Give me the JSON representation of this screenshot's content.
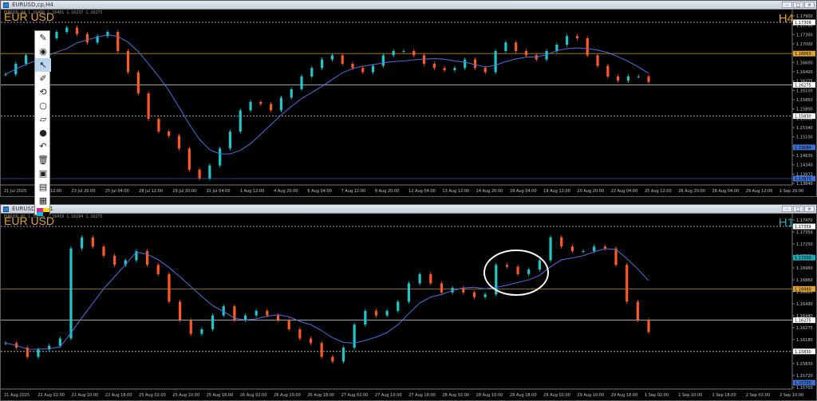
{
  "windows": [
    {
      "title": "EURUSD,cp,H4",
      "info": "EURUSD,H4 1.16466 1.16481 1.16237 1.16275",
      "symbol": "EUR USD",
      "timeframe": "H4",
      "timeframe_color": "#e0a32e",
      "price_ticks": [
        "1.17900",
        "1.17700",
        "1.17300",
        "1.17000",
        "1.16890",
        "1.16600",
        "1.16400",
        "1.16275",
        "1.16100",
        "1.15850",
        "1.15800",
        "1.15560",
        "1.15340",
        "1.15100",
        "1.14800",
        "1.14630",
        "1.14340",
        "1.13973",
        "1.13840"
      ],
      "time_labels": [
        "21 Jul 2025",
        "22 Jul 12:00",
        "23 Jul 20:00",
        "25 Jul 04:00",
        "28 Jul 12:00",
        "29 Jul 20:00",
        "31 Jul 04:00",
        "1 Aug 12:00",
        "4 Aug 20:00",
        "6 Aug 04:00",
        "7 Aug 12:00",
        "8 Aug 20:00",
        "12 Aug 04:00",
        "13 Aug 12:00",
        "14 Aug 20:00",
        "18 Aug 04:00",
        "19 Aug 12:00",
        "20 Aug 20:00",
        "22 Aug 04:00",
        "25 Aug 12:00",
        "26 Aug 20:00",
        "28 Aug 04:00",
        "29 Aug 12:00",
        "1 Sep 20:00"
      ],
      "level_tags": [
        {
          "text": "1.17309",
          "type": "dotted",
          "color": "#ffffff"
        },
        {
          "text": "1.16863",
          "type": "solid",
          "color": "#e0a32e"
        },
        {
          "text": "1.16275",
          "type": "solid",
          "color": "#ffffff"
        },
        {
          "text": "1.15830",
          "type": "dotted",
          "color": "#ffffff"
        },
        {
          "text": "1.15684",
          "type": "tag",
          "color": "#3b6fd0"
        },
        {
          "text": "1.13973",
          "type": "solid",
          "color": "#3b6fd0"
        }
      ]
    },
    {
      "title": "EURUSD,cp,H1",
      "info": "EURUSD,H1 1.16374 1.16419 1.16284 1.16275",
      "symbol": "EUR USD",
      "timeframe": "H1",
      "timeframe_color": "#1aa7b0",
      "price_ticks": [
        "1.17470",
        "1.17359",
        "1.17250",
        "1.17030",
        "1.16960",
        "1.16860",
        "1.16620",
        "1.16490",
        "1.16440",
        "1.16275",
        "1.16180",
        "1.16060",
        "1.15830",
        "1.15720",
        "1.15700"
      ],
      "time_labels": [
        "21 Aug 2025",
        "22 Aug 02:00",
        "22 Aug 10:00",
        "22 Aug 18:00",
        "25 Aug 02:00",
        "25 Aug 10:00",
        "25 Aug 18:00",
        "26 Aug 02:00",
        "26 Aug 10:00",
        "26 Aug 18:00",
        "27 Aug 02:00",
        "27 Aug 10:00",
        "27 Aug 18:00",
        "28 Aug 02:00",
        "28 Aug 10:00",
        "28 Aug 18:00",
        "29 Aug 02:00",
        "29 Aug 10:00",
        "29 Aug 18:00",
        "1 Sep 02:00",
        "1 Sep 10:00",
        "1 Sep 18:00",
        "2 Sep 02:00",
        "2 Sep 10:00"
      ],
      "level_tags": [
        {
          "text": "1.17359",
          "type": "dotted",
          "color": "#ffffff"
        },
        {
          "text": "1.17250",
          "type": "tag",
          "color": "#1aa7b0"
        },
        {
          "text": "1.16960",
          "type": "solid",
          "color": "#e0a32e"
        },
        {
          "text": "1.16275",
          "type": "solid",
          "color": "#ffffff"
        },
        {
          "text": "1.15830",
          "type": "dotted",
          "color": "#ffffff"
        },
        {
          "text": "1.15720",
          "type": "tag",
          "color": "#3b6fd0"
        }
      ]
    }
  ],
  "toolbar": {
    "tools": [
      "pin-icon",
      "eye-icon",
      "cursor-icon",
      "pencil-icon",
      "rotate-icon",
      "circle-icon",
      "ruler-icon",
      "dot-icon",
      "undo-icon",
      "trash-icon",
      "bus-icon",
      "camera-icon",
      "clipboard-icon"
    ],
    "palette": [
      "#e0218a",
      "#ffd400",
      "#00b7eb",
      "#000000"
    ]
  },
  "chart_data": [
    {
      "type": "candlestick",
      "title": "EURUSD,H4",
      "up_color": "#1ec8c8",
      "down_color": "#ff5a1f",
      "ma_color": "#4f6fe6",
      "ylim": [
        1.1384,
        1.1794
      ],
      "ohlc_path": [
        1.1645,
        1.167,
        1.169,
        1.1705,
        1.173,
        1.1745,
        1.1755,
        1.174,
        1.172,
        1.1735,
        1.1745,
        1.17,
        1.165,
        1.16,
        1.154,
        1.151,
        1.15,
        1.147,
        1.142,
        1.14,
        1.143,
        1.147,
        1.151,
        1.156,
        1.158,
        1.1575,
        1.156,
        1.159,
        1.161,
        1.164,
        1.166,
        1.168,
        1.169,
        1.167,
        1.166,
        1.165,
        1.1665,
        1.169,
        1.17,
        1.17,
        1.169,
        1.167,
        1.166,
        1.1655,
        1.166,
        1.168,
        1.166,
        1.165,
        1.17,
        1.172,
        1.17,
        1.169,
        1.168,
        1.17,
        1.1715,
        1.1735,
        1.173,
        1.169,
        1.1665,
        1.164,
        1.163,
        1.164,
        1.164,
        1.1627
      ],
      "annotations": [
        "H4",
        "EUR USD"
      ]
    },
    {
      "type": "candlestick",
      "title": "EURUSD,H1",
      "up_color": "#1ec8c8",
      "down_color": "#ff5a1f",
      "ma_color": "#4f6fe6",
      "ylim": [
        1.1565,
        1.1754
      ],
      "ohlc_path": [
        1.1615,
        1.161,
        1.16,
        1.1608,
        1.1612,
        1.162,
        1.1718,
        1.173,
        1.172,
        1.171,
        1.17,
        1.1705,
        1.1715,
        1.17,
        1.169,
        1.166,
        1.164,
        1.1625,
        1.163,
        1.1645,
        1.1655,
        1.164,
        1.1645,
        1.165,
        1.1645,
        1.164,
        1.163,
        1.162,
        1.1615,
        1.16,
        1.1595,
        1.161,
        1.1635,
        1.165,
        1.1645,
        1.165,
        1.166,
        1.168,
        1.169,
        1.168,
        1.167,
        1.1675,
        1.167,
        1.1665,
        1.1668,
        1.17,
        1.1698,
        1.169,
        1.1695,
        1.1705,
        1.173,
        1.172,
        1.1715,
        1.1715,
        1.172,
        1.1718,
        1.17,
        1.166,
        1.164,
        1.1627
      ],
      "annotations": [
        "H1",
        "EUR USD"
      ],
      "highlight": "ellipse"
    }
  ]
}
